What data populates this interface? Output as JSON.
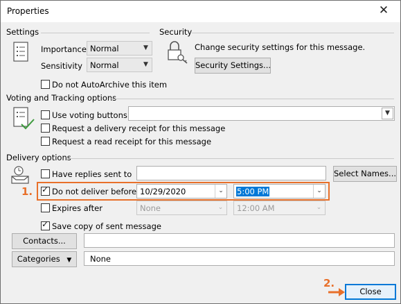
{
  "window": {
    "title": "Properties"
  },
  "settings": {
    "heading": "Settings",
    "importance_label": "Importance",
    "importance_value": "Normal",
    "sensitivity_label": "Sensitivity",
    "sensitivity_value": "Normal",
    "autoarchive_label": "Do not AutoArchive this item",
    "autoarchive_checked": false
  },
  "security": {
    "heading": "Security",
    "description": "Change security settings for this message.",
    "button_label": "Security Settings..."
  },
  "voting": {
    "heading": "Voting and Tracking options",
    "use_voting_label": "Use voting buttons",
    "use_voting_value": "",
    "delivery_receipt_label": "Request a delivery receipt for this message",
    "read_receipt_label": "Request a read receipt for this message"
  },
  "delivery": {
    "heading": "Delivery options",
    "replies_label": "Have replies sent to",
    "replies_value": "",
    "select_names_label": "Select Names...",
    "do_not_deliver_label": "Do not deliver before",
    "do_not_deliver_checked": true,
    "do_not_deliver_date": "10/29/2020",
    "do_not_deliver_time": "5:00 PM",
    "expires_label": "Expires after",
    "expires_checked": false,
    "expires_date": "None",
    "expires_time": "12:00 AM",
    "save_copy_label": "Save copy of sent message",
    "save_copy_checked": true
  },
  "contacts": {
    "button_label": "Contacts...",
    "value": ""
  },
  "categories": {
    "button_label": "Categories",
    "value": "None"
  },
  "footer": {
    "close_label": "Close"
  },
  "annotations": {
    "step1": "1.",
    "step2": "2."
  },
  "colors": {
    "highlight": "#e8702a",
    "accent": "#0078d7"
  }
}
